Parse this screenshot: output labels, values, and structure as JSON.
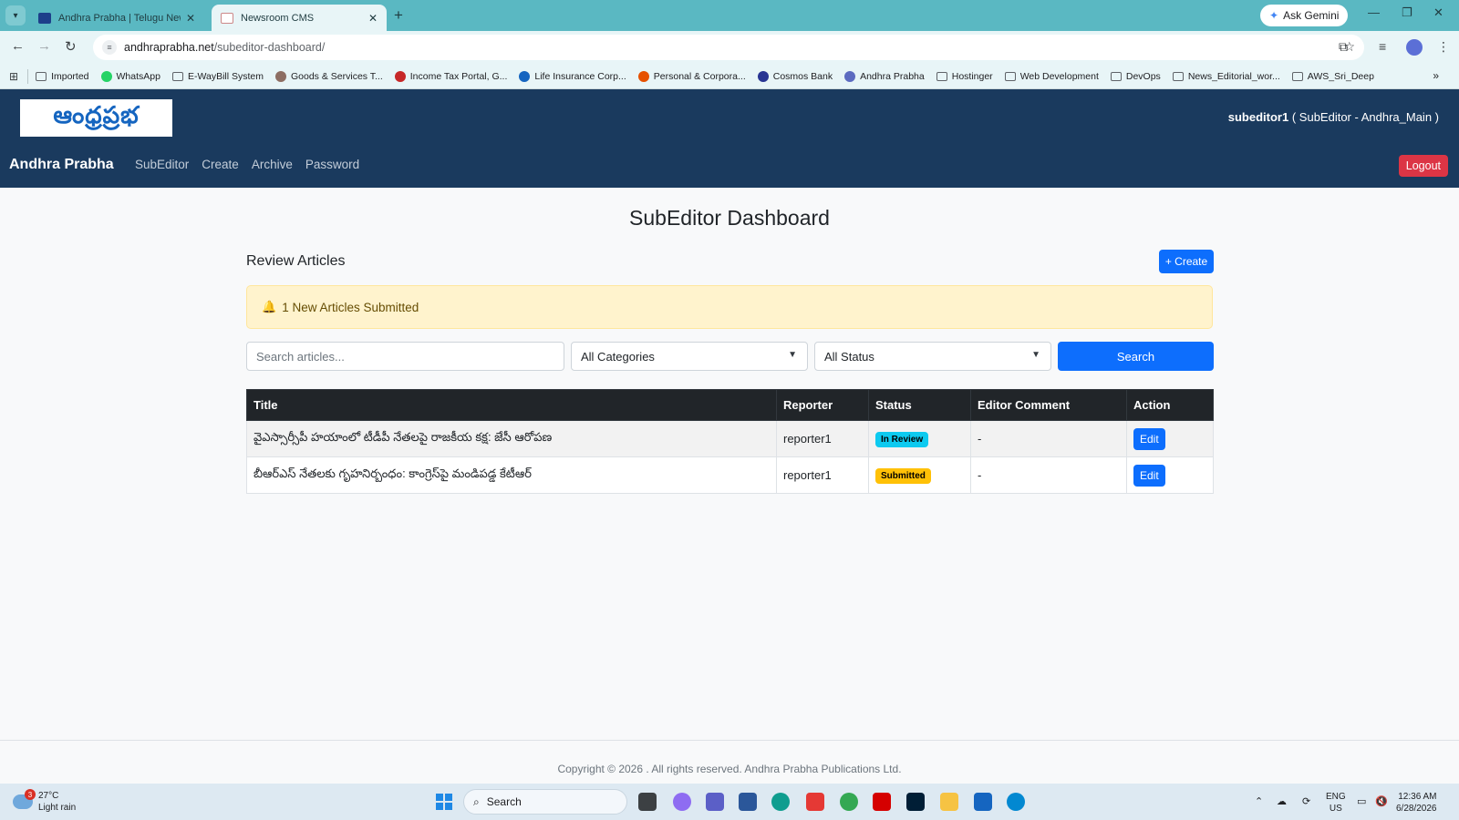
{
  "browser": {
    "tabs": [
      {
        "title": "Andhra Prabha | Telugu News D",
        "active": false
      },
      {
        "title": "Newsroom CMS",
        "active": true
      }
    ],
    "gemini_label": "Ask Gemini",
    "url_host": "andhraprabha.net",
    "url_path": "/subeditor-dashboard/",
    "bookmarks": [
      "Imported",
      "WhatsApp",
      "E-WayBill System",
      "Goods & Services T...",
      "Income Tax Portal, G...",
      "Life Insurance Corp...",
      "Personal & Corpora...",
      "Cosmos Bank",
      "Andhra Prabha",
      "Hostinger",
      "Web Development",
      "DevOps",
      "News_Editorial_wor...",
      "AWS_Sri_Deep"
    ]
  },
  "header": {
    "logo_text": "ఆంధ్రప్రభ",
    "user_name": "subeditor1",
    "user_role": "( SubEditor - Andhra_Main )",
    "brand": "Andhra Prabha",
    "nav": [
      "SubEditor",
      "Create",
      "Archive",
      "Password"
    ],
    "logout_label": "Logout"
  },
  "main": {
    "title": "SubEditor Dashboard",
    "section_title": "Review Articles",
    "create_label": "+ Create",
    "alert_text": "1 New Articles Submitted",
    "search_placeholder": "Search articles...",
    "category_selected": "All Categories",
    "status_selected": "All Status",
    "search_label": "Search",
    "table": {
      "headers": [
        "Title",
        "Reporter",
        "Status",
        "Editor Comment",
        "Action"
      ],
      "rows": [
        {
          "title": "వైఎస్సార్సీపీ హయాంలో టీడీపీ నేతలపై రాజకీయ కక్ష: జేసీ ఆరోపణ",
          "reporter": "reporter1",
          "status": "In Review",
          "comment": "-",
          "action": "Edit"
        },
        {
          "title": "బీఆర్ఎస్ నేతలకు గృహనిర్బంధం: కాంగ్రెస్‌పై మండిపడ్డ కేటీఆర్",
          "reporter": "reporter1",
          "status": "Submitted",
          "comment": "-",
          "action": "Edit"
        }
      ]
    }
  },
  "footer": {
    "copyright": "Copyright © 2026 . All rights reserved. Andhra Prabha Publications Ltd."
  },
  "taskbar": {
    "weather_badge": "3",
    "temperature": "27°C",
    "condition": "Light rain",
    "search_label": "Search",
    "lang_line1": "ENG",
    "lang_line2": "US",
    "time": "12:36 AM",
    "date": "6/28/2026"
  },
  "colors": {
    "header_bg": "#1a3a5e",
    "primary": "#0d6efd",
    "danger": "#dc3545",
    "badge_review": "#0dcaf0",
    "badge_submitted": "#ffc107",
    "alert_bg": "#fff3cd"
  }
}
